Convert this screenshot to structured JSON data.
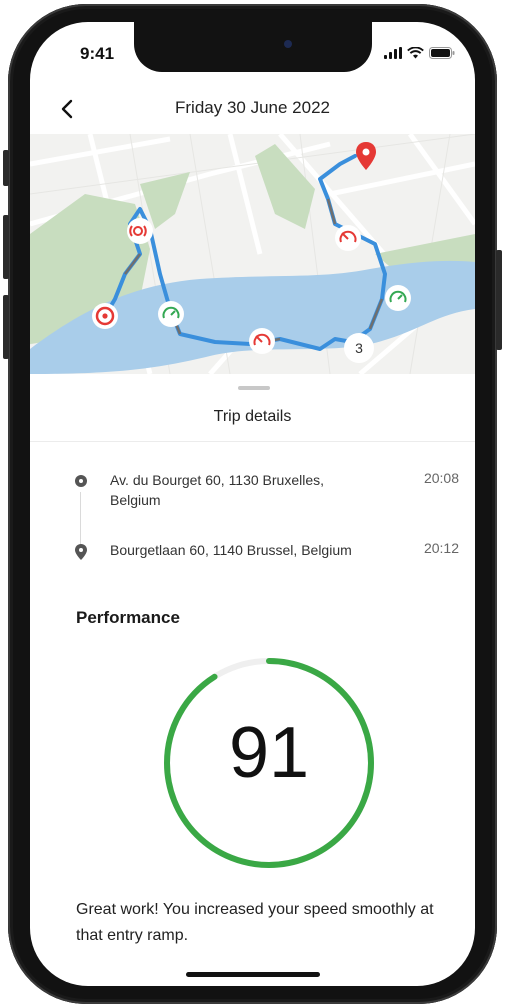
{
  "status_bar": {
    "time": "9:41"
  },
  "header": {
    "title": "Friday 30 June 2022",
    "back_icon": "chevron-left-icon"
  },
  "map": {
    "route_marker_label": "3",
    "colors": {
      "water": "#a9cdea",
      "park": "#c8ddbf",
      "route": "#3a8fdc",
      "event_red": "#e53935",
      "event_green": "#34a853"
    }
  },
  "trip_details": {
    "title": "Trip details",
    "stops": [
      {
        "icon": "origin-dot-icon",
        "address": "Av. du Bourget 60, 1130 Bruxelles, Belgium",
        "time": "20:08"
      },
      {
        "icon": "destination-pin-icon",
        "address": "Bourgetlaan 60, 1140 Brussel, Belgium",
        "time": "20:12"
      }
    ]
  },
  "performance": {
    "title": "Performance",
    "score": "91",
    "score_fraction": 0.91,
    "accent": "#3aa845",
    "message": "Great work! You increased your speed smoothly at that entry ramp."
  }
}
